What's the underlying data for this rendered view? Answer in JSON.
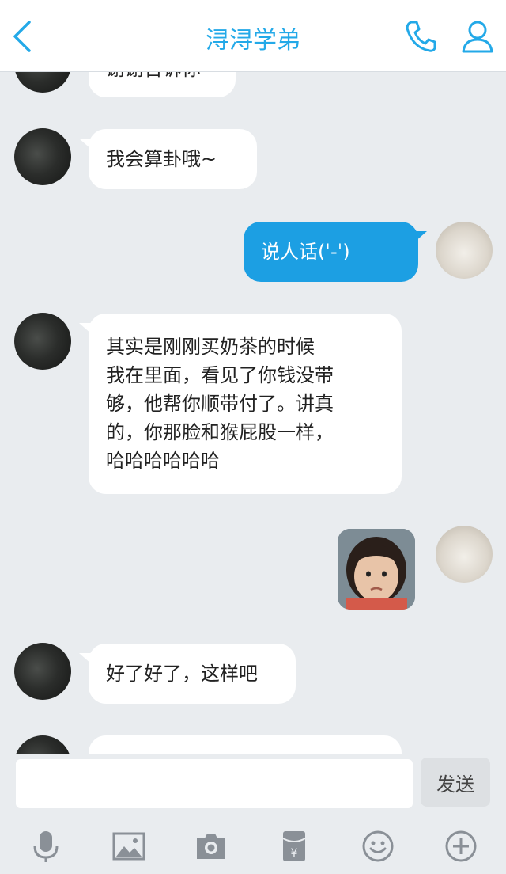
{
  "header": {
    "title": "浔浔学弟"
  },
  "messages": [
    {
      "side": "in",
      "text": "谢谢告诉你"
    },
    {
      "side": "in",
      "text": "我会算卦哦~"
    },
    {
      "side": "out",
      "text": "说人话(ˈ-ˈ)"
    },
    {
      "side": "in",
      "lines": [
        "其实是刚刚买奶茶的时候",
        "我在里面，看见了你钱没带",
        "够，他帮你顺带付了。讲真",
        "的，你那脸和猴屁股一样，",
        "哈哈哈哈哈哈"
      ]
    },
    {
      "side": "out",
      "type": "sticker"
    },
    {
      "side": "in",
      "text": "好了好了，这样吧"
    }
  ],
  "composer": {
    "send_label": "发送"
  },
  "toolbar": [
    "microphone-icon",
    "image-icon",
    "camera-icon",
    "red-packet-icon",
    "emoji-icon",
    "plus-icon"
  ],
  "colors": {
    "accent": "#23a9e8",
    "out_bubble": "#1c9fe3",
    "background": "#e9ecef"
  }
}
